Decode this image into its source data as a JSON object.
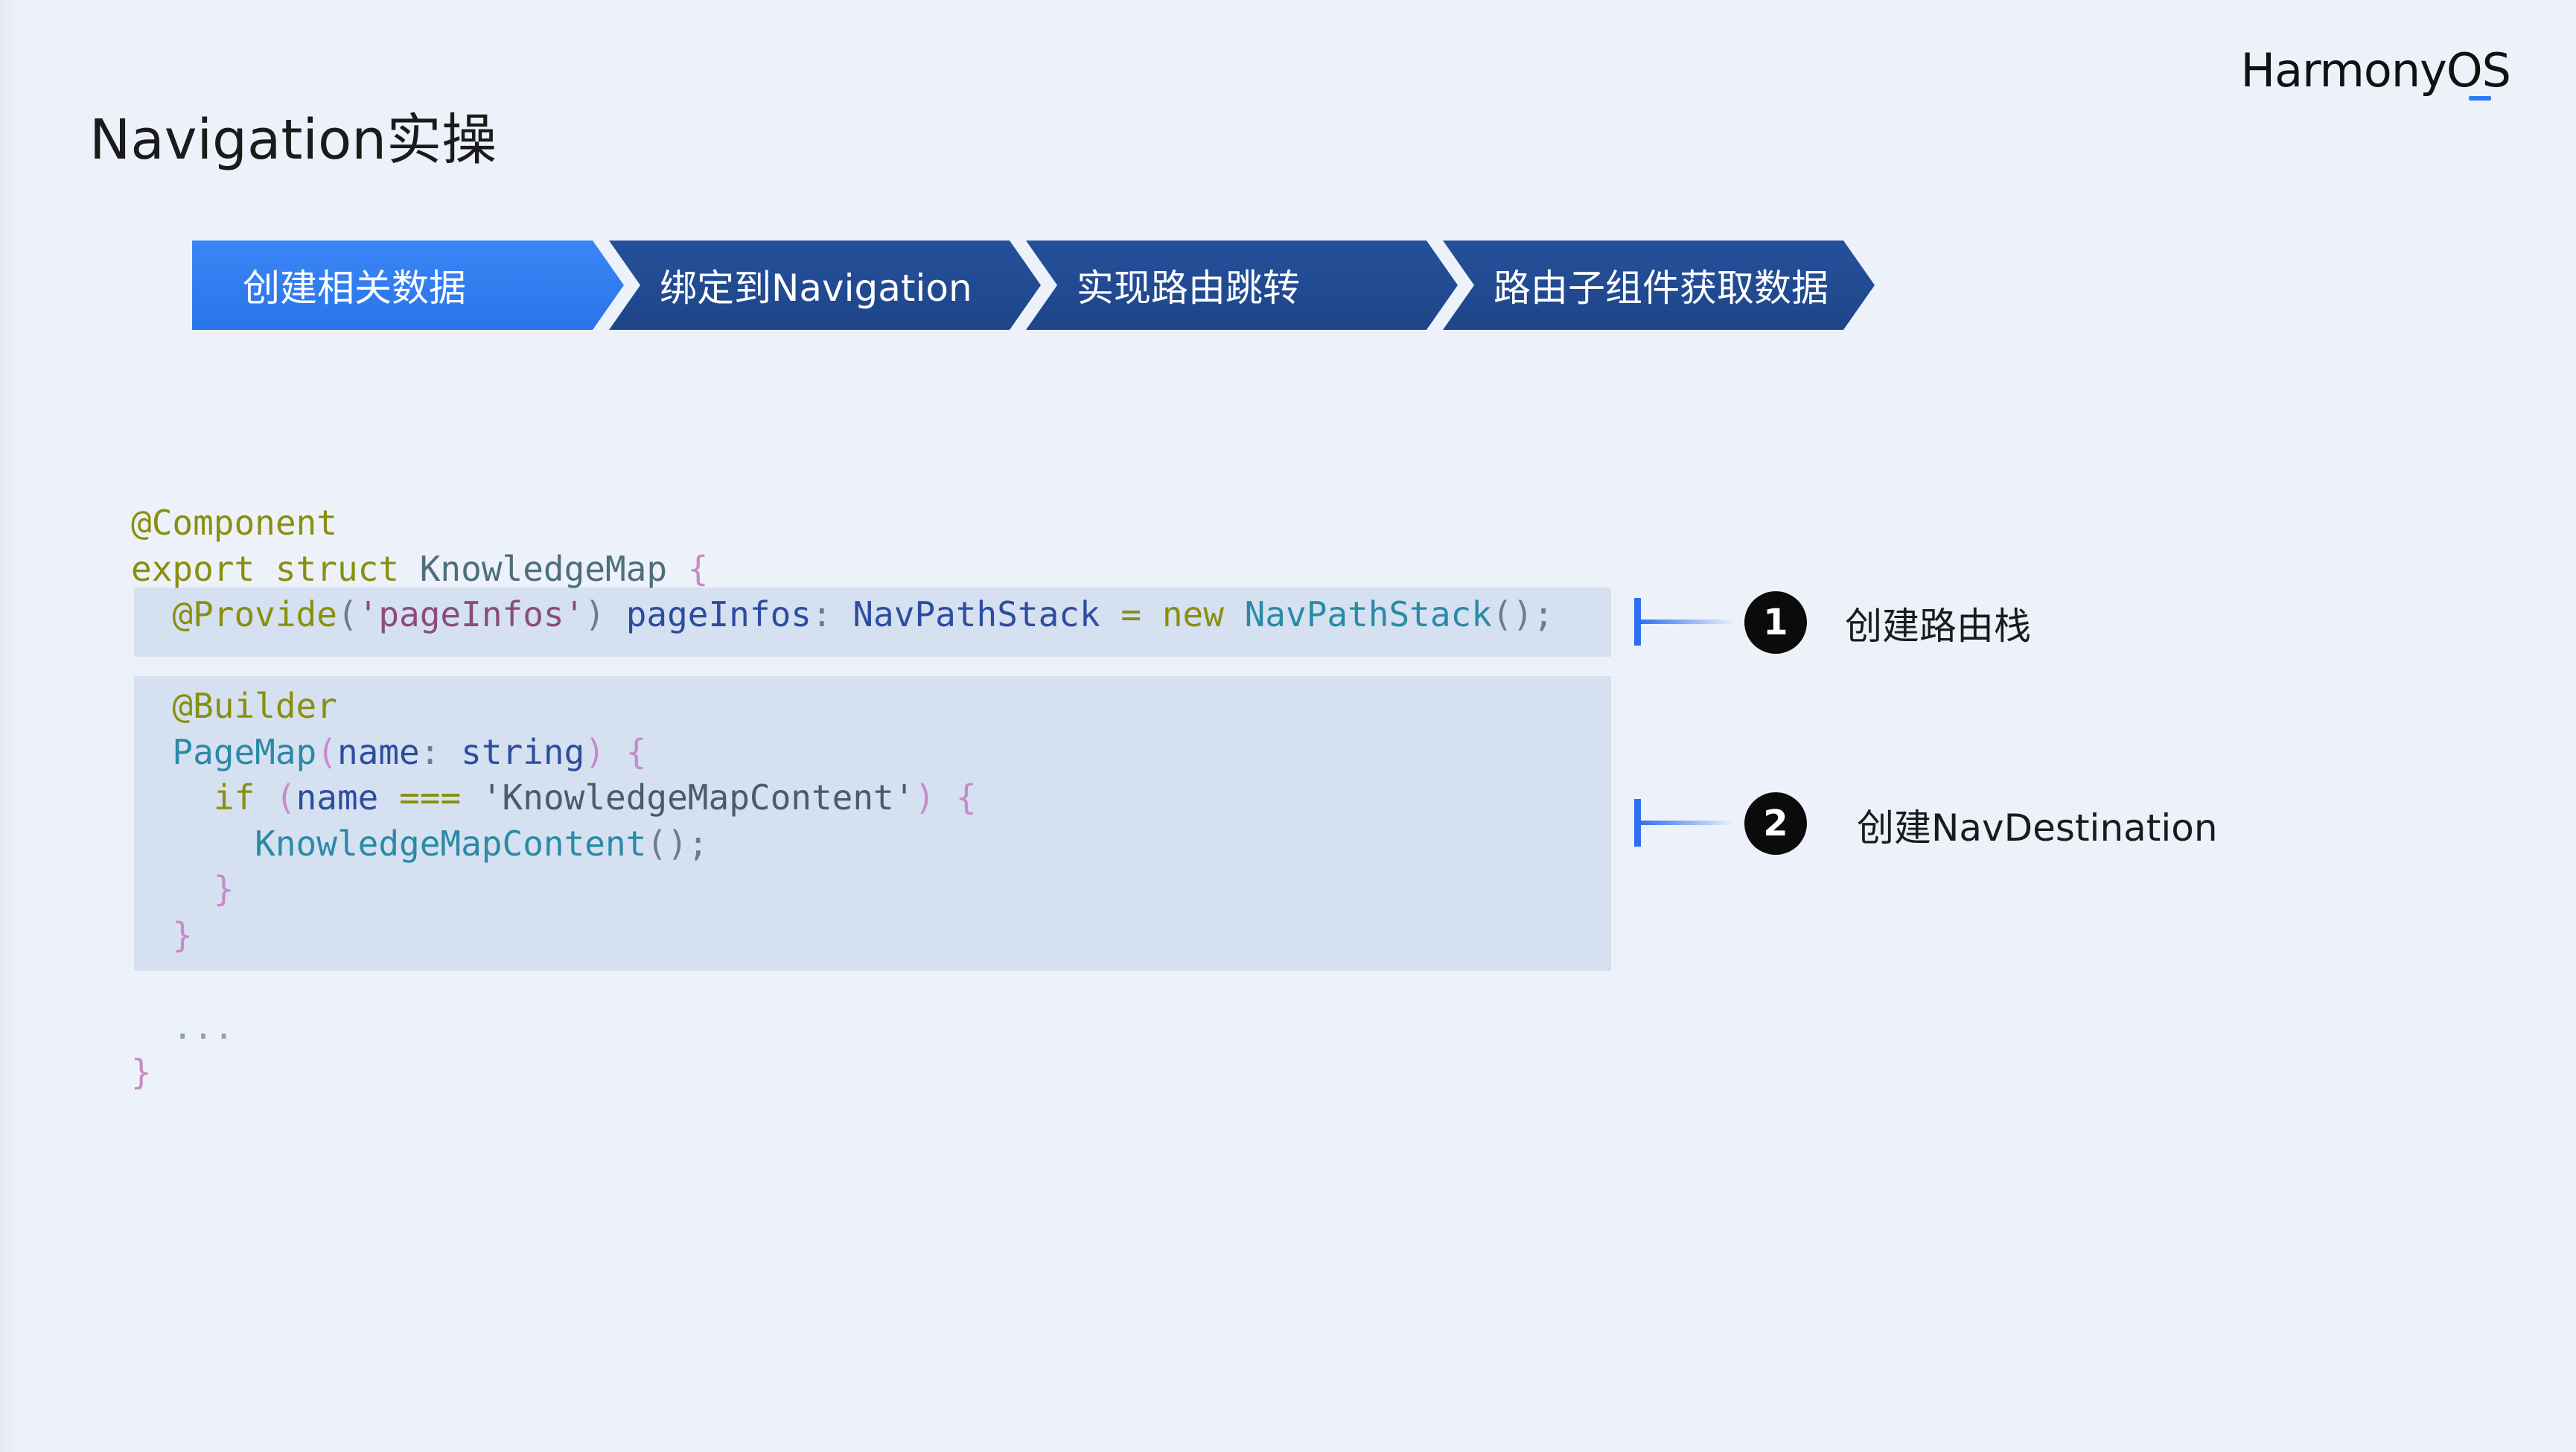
{
  "slide": {
    "title": "Navigation实操",
    "logo": "HarmonyOS"
  },
  "steps": [
    {
      "label": "创建相关数据",
      "active": true
    },
    {
      "label": "绑定到Navigation",
      "active": false
    },
    {
      "label": "实现路由跳转",
      "active": false
    },
    {
      "label": "路由子组件获取数据",
      "active": false
    }
  ],
  "code": {
    "l1": {
      "t1": "@Component"
    },
    "l2": {
      "t1": "export struct",
      "t2": "KnowledgeMap",
      "t3": "{"
    },
    "l3": {
      "t1": "@Provide",
      "t2": "(",
      "t3": "'pageInfos'",
      "t4": ")",
      "t5": "pageInfos",
      "t6": ":",
      "t7": "NavPathStack",
      "t8": "=",
      "t9": "new",
      "t10": "NavPathStack",
      "t11": "();"
    },
    "l4": {
      "t1": "@Builder"
    },
    "l5": {
      "t1": "PageMap",
      "t2": "(",
      "t3": "name",
      "t4": ":",
      "t5": "string",
      "t6": ")",
      "t7": "{"
    },
    "l6": {
      "t1": "if",
      "t2": "(",
      "t3": "name",
      "t4": "===",
      "t5": "'KnowledgeMapContent'",
      "t6": ")",
      "t7": "{"
    },
    "l7": {
      "t1": "KnowledgeMapContent",
      "t2": "();"
    },
    "l8": {
      "t1": "}"
    },
    "l9": {
      "t1": "}"
    },
    "l10": {
      "t1": "..."
    },
    "l11": {
      "t1": "}"
    }
  },
  "annotations": [
    {
      "number": "1",
      "text": "创建路由栈"
    },
    {
      "number": "2",
      "text": "创建NavDestination"
    }
  ],
  "colors": {
    "background": "#edf2fa",
    "step_active": "#2e7cf2",
    "step_inactive": "#22499a",
    "highlight": "#d5e1f1",
    "bracket": "#2e6ef0"
  }
}
